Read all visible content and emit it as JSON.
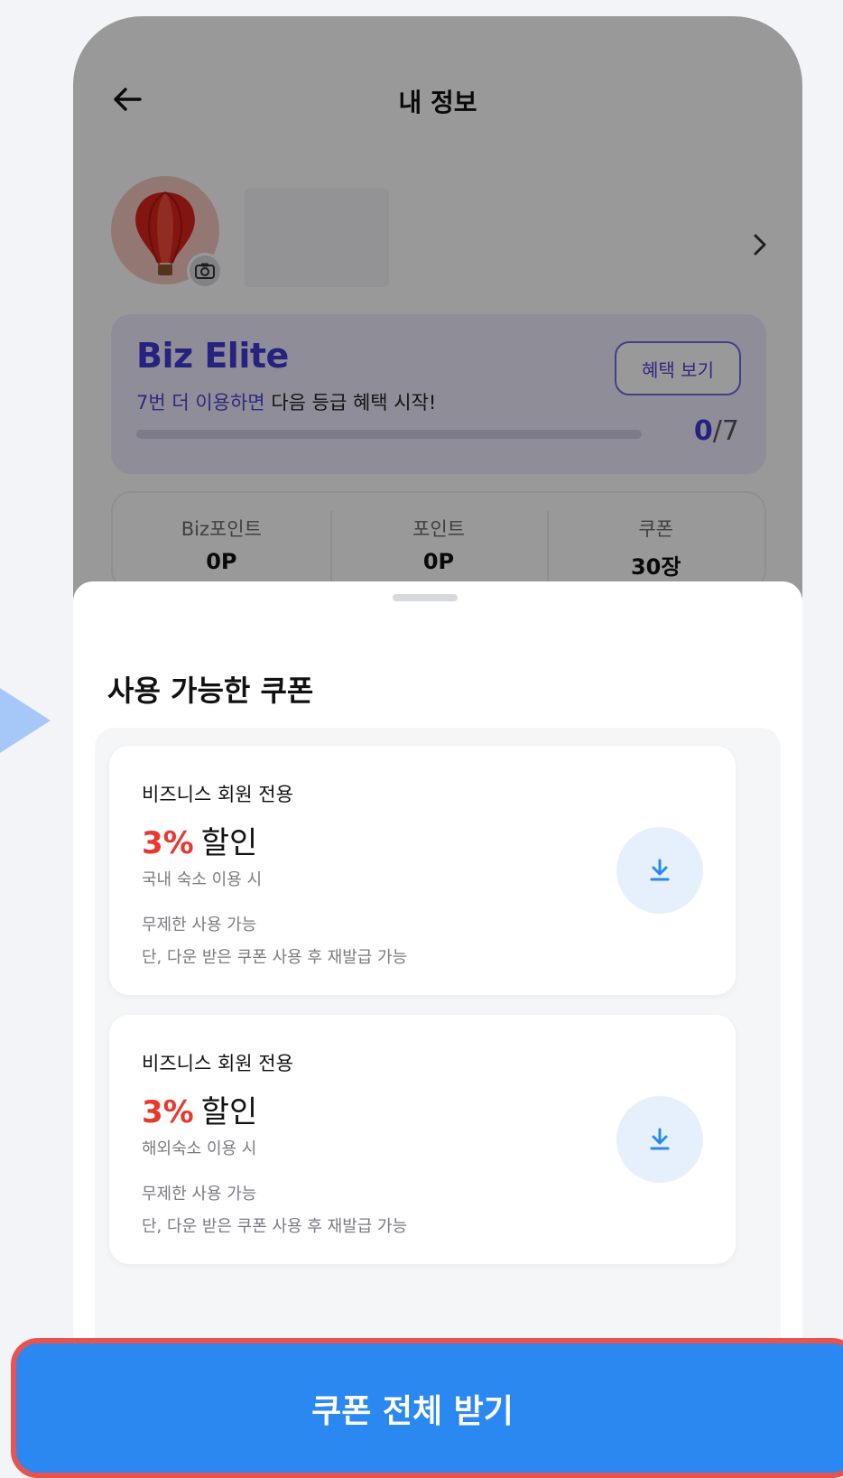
{
  "header": {
    "title": "내 정보"
  },
  "grade": {
    "name": "Biz Elite",
    "message_highlight": "7번 더 이용하면",
    "message_rest": " 다음 등급 혜택 시작!",
    "benefit_button": "혜택 보기",
    "progress_current": "0",
    "progress_total": "/7",
    "progress_fraction": 0.0,
    "accent_color": "#4a46d8"
  },
  "stats": [
    {
      "label": "Biz포인트",
      "value": "0P"
    },
    {
      "label": "포인트",
      "value": "0P"
    },
    {
      "label": "쿠폰",
      "value": "30장"
    }
  ],
  "sheet": {
    "title": "사용 가능한 쿠폰",
    "coupons": [
      {
        "category": "비즈니스 회원 전용",
        "percent": "3%",
        "discount_word": "할인",
        "condition": "국내 숙소 이용 시",
        "limit": "무제한 사용 가능",
        "note": "단, 다운 받은 쿠폰 사용 후 재발급 가능"
      },
      {
        "category": "비즈니스 회원 전용",
        "percent": "3%",
        "discount_word": "할인",
        "condition": "해외숙소 이용 시",
        "limit": "무제한 사용 가능",
        "note": "단, 다운 받은 쿠폰 사용 후 재발급 가능"
      }
    ]
  },
  "cta": {
    "label": "쿠폰 전체 받기",
    "color": "#2b88f0",
    "highlight_border": "#e8524f"
  },
  "icons": [
    "back-arrow-icon",
    "hot-air-balloon-icon",
    "camera-icon",
    "chevron-right-icon",
    "download-icon"
  ]
}
